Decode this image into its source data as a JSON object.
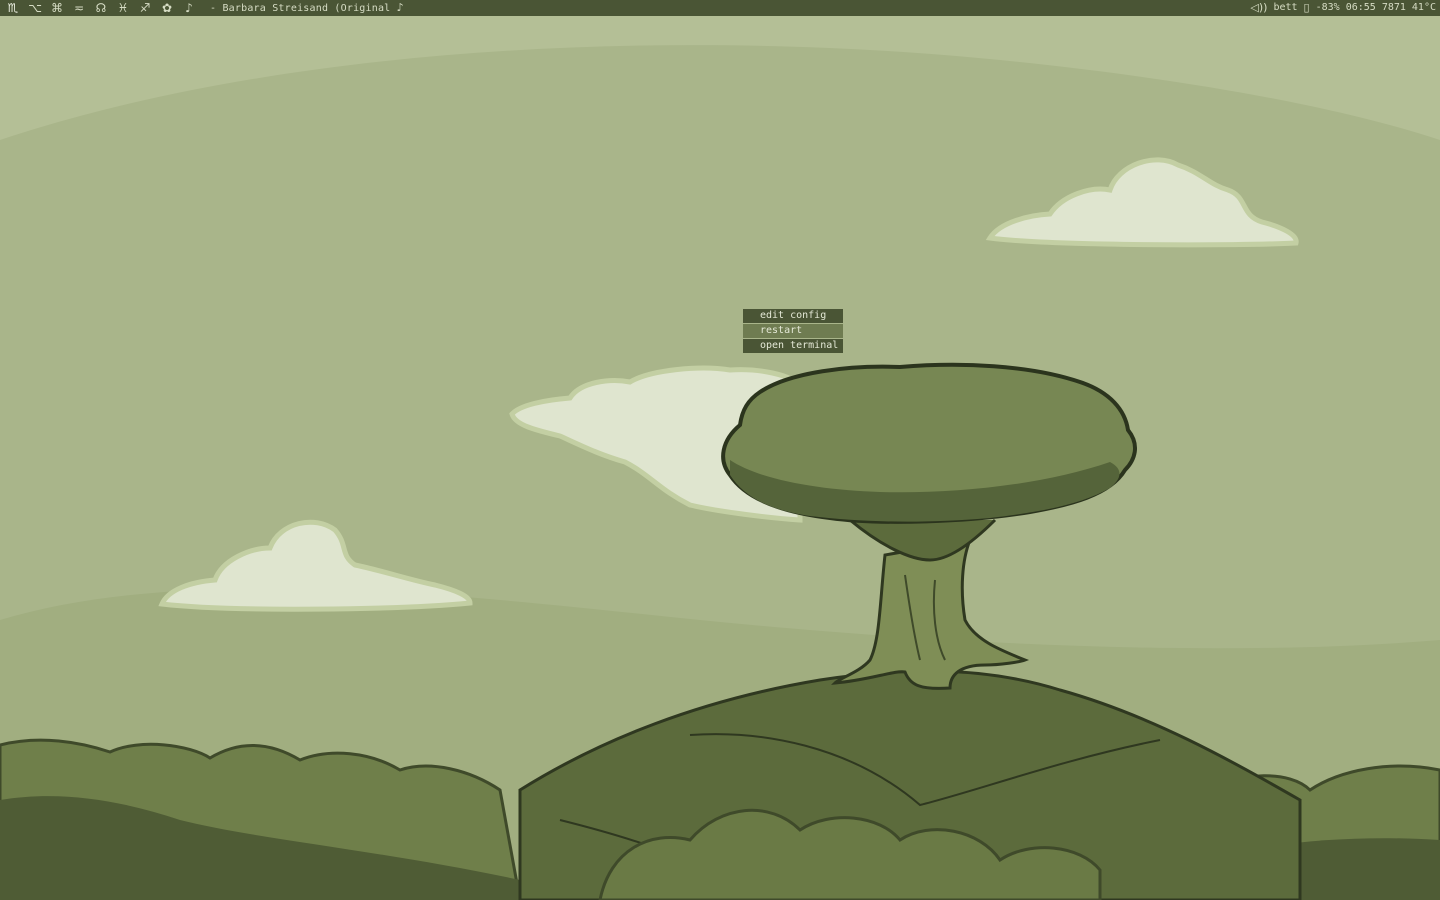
{
  "topbar": {
    "tags": [
      {
        "icon": "scorpio-glyph",
        "glyph": "♏",
        "active": true
      },
      {
        "icon": "option-key-glyph",
        "glyph": "⌥",
        "active": false
      },
      {
        "icon": "command-key-glyph",
        "glyph": "⌘",
        "active": false
      },
      {
        "icon": "approx-glyph",
        "glyph": "≂",
        "active": false
      },
      {
        "icon": "headphones-glyph",
        "glyph": "☊",
        "active": false
      },
      {
        "icon": "pisces-glyph",
        "glyph": "♓",
        "active": false
      },
      {
        "icon": "sagittarius-glyph",
        "glyph": "♐",
        "active": false
      },
      {
        "icon": "flower-glyph",
        "glyph": "✿",
        "active": false
      },
      {
        "icon": "music-note-glyph",
        "glyph": "♪",
        "active": false
      }
    ],
    "now_playing": "- Barbara Streisand (Original",
    "now_playing_note": "♪",
    "status": {
      "wifi_glyph": "◁))",
      "network": "bett",
      "battery_glyph": "▯",
      "battery": "-83%",
      "clock": "06:55",
      "memory": "7871",
      "temperature": "41°C"
    }
  },
  "menu": {
    "items": [
      {
        "label": "edit config",
        "selected": false
      },
      {
        "label": "restart",
        "selected": true
      },
      {
        "label": "open terminal",
        "selected": false
      }
    ]
  },
  "colors": {
    "panel_bg": "#4a5535",
    "panel_fg": "#d6dcc4",
    "menu_selected": "#6f7c51",
    "sky": "#a9b58a"
  }
}
